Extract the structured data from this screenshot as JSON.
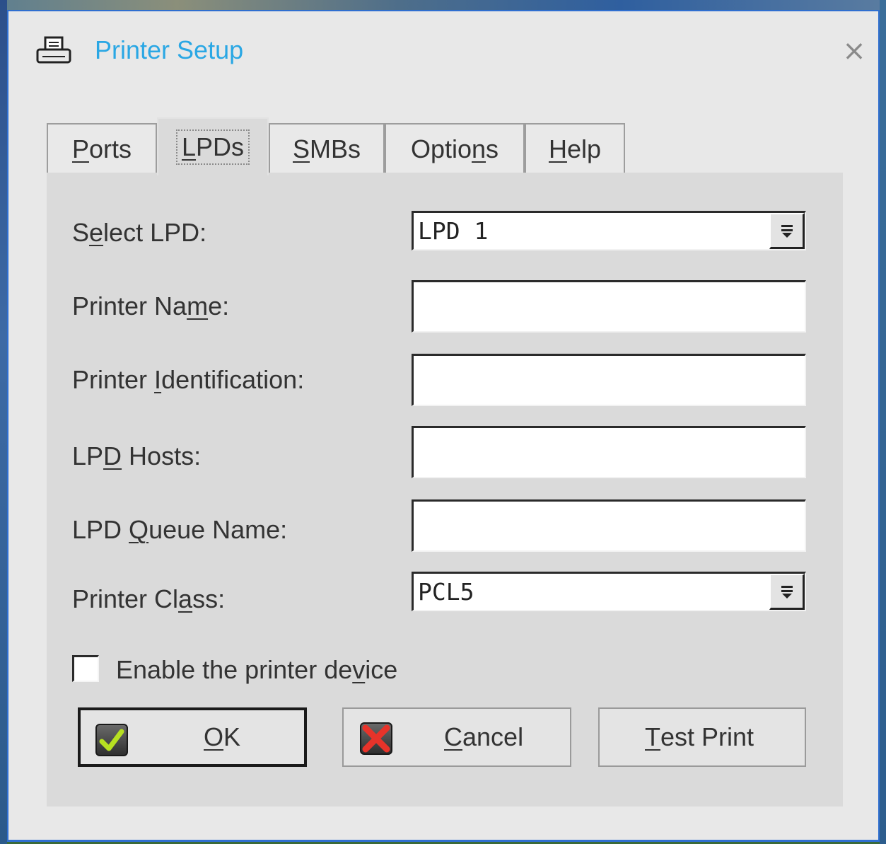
{
  "window": {
    "title": "Printer Setup",
    "icon": "printer-icon",
    "close_icon": "close-icon",
    "accent_color": "#2aa7e4",
    "border_color": "#2f6fd0"
  },
  "tabs": [
    {
      "pre": "",
      "mn": "P",
      "post": "orts",
      "active": false
    },
    {
      "pre": "",
      "mn": "L",
      "post": "PDs",
      "active": true
    },
    {
      "pre": "",
      "mn": "S",
      "post": "MBs",
      "active": false
    },
    {
      "pre": "Optio",
      "mn": "n",
      "post": "s",
      "active": false
    },
    {
      "pre": "",
      "mn": "H",
      "post": "elp",
      "active": false
    }
  ],
  "form": {
    "select_lpd": {
      "pre": "S",
      "mn": "e",
      "post": "lect LPD:",
      "value": "LPD 1"
    },
    "printer_name": {
      "pre": "Printer Na",
      "mn": "m",
      "post": "e:",
      "value": ""
    },
    "printer_identification": {
      "pre": "Printer ",
      "mn": "I",
      "post": "dentification:",
      "value": ""
    },
    "lpd_hosts": {
      "pre": "LP",
      "mn": "D",
      "post": " Hosts:",
      "value": ""
    },
    "lpd_queue_name": {
      "pre": "LPD ",
      "mn": "Q",
      "post": "ueue Name:",
      "value": ""
    },
    "printer_class": {
      "pre": "Printer Cl",
      "mn": "a",
      "post": "ss:",
      "value": "PCL5"
    },
    "enable_device": {
      "pre": "Enable the printer de",
      "mn": "v",
      "post": "ice",
      "checked": false
    }
  },
  "buttons": {
    "ok": {
      "pre": "",
      "mn": "O",
      "post": "K",
      "icon": "check-icon"
    },
    "cancel": {
      "pre": "",
      "mn": "C",
      "post": "ancel",
      "icon": "x-icon"
    },
    "test_print": {
      "pre": "",
      "mn": "T",
      "post": "est Print"
    }
  }
}
